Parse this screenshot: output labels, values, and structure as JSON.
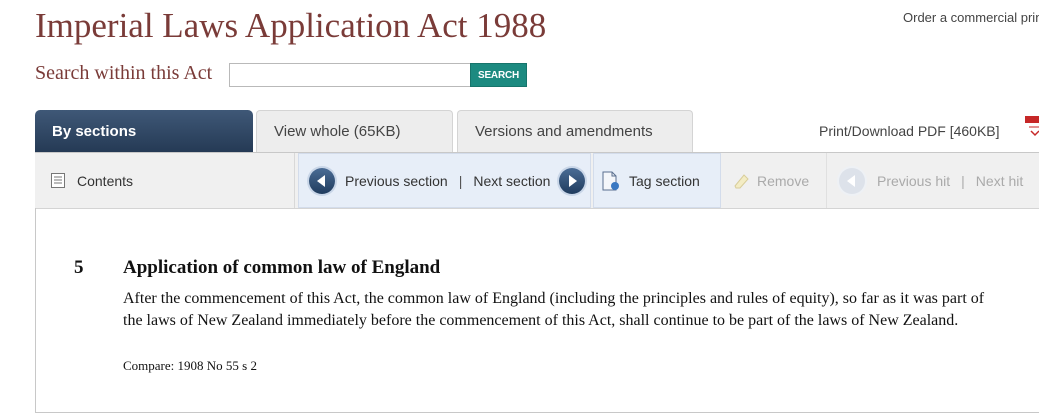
{
  "header": {
    "title": "Imperial Laws Application Act 1988",
    "order_link": "Order a commercial prin"
  },
  "search": {
    "label": "Search within this Act",
    "value": "",
    "placeholder": "",
    "button": "SEARCH"
  },
  "tabs": {
    "by_sections": "By sections",
    "view_whole": "View whole (65KB)",
    "versions": "Versions and amendments",
    "print_pdf": "Print/Download PDF [460KB]"
  },
  "toolbar": {
    "contents": "Contents",
    "previous_section": "Previous section",
    "separator": "|",
    "next_section": "Next section",
    "tag_section": "Tag section",
    "remove": "Remove",
    "previous_hit": "Previous hit",
    "next_hit": "Next hit"
  },
  "section": {
    "number": "5",
    "heading": "Application of common law of England",
    "body": "After the commencement of this Act, the common law of England (including the principles and rules of equity), so far as it was part of the laws of New Zealand immediately before the commencement of this Act, shall continue to be part of the laws of New Zealand.",
    "compare": "Compare: 1908 No 55 s 2"
  },
  "colors": {
    "title": "#7a3b38",
    "search_button": "#1c8a80",
    "active_tab": "#2f4666",
    "nav_highlight": "#e7eef8"
  },
  "icons": {
    "contents": "document-icon",
    "previous": "arrow-left-circle-icon",
    "next": "arrow-right-circle-icon",
    "tag": "tag-document-icon",
    "remove": "eraser-icon",
    "pdf": "pdf-icon"
  }
}
